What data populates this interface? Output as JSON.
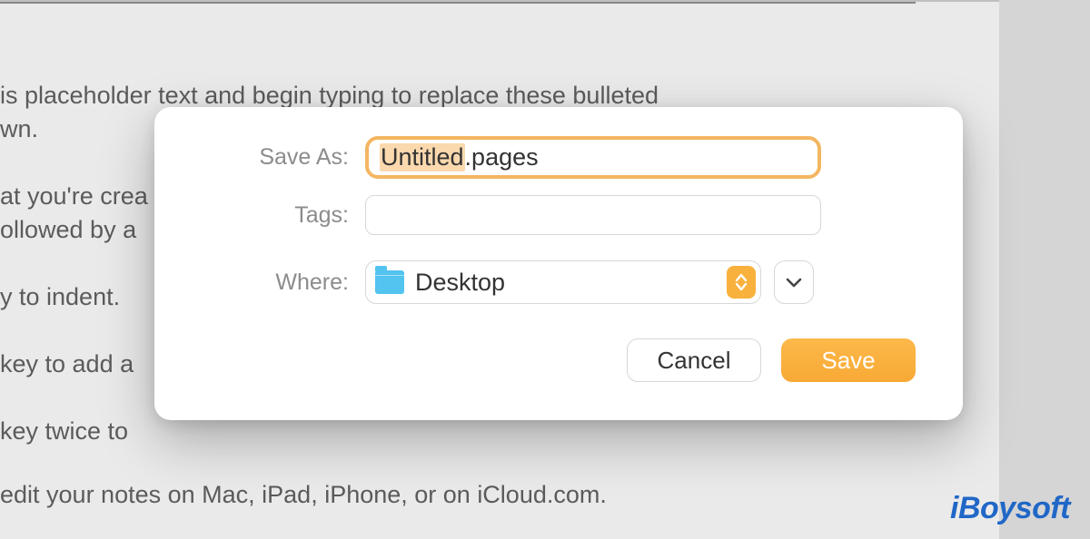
{
  "document": {
    "line1": "is placeholder text and begin typing to replace these bulleted",
    "line2": "wn.",
    "line3": "at you're crea",
    "line4": "ollowed by a",
    "line5": "y to indent.",
    "line6": "key to add a",
    "line7": "key twice to",
    "line8": "edit your notes on Mac, iPad, iPhone, or on iCloud.com."
  },
  "dialog": {
    "saveAsLabel": "Save As:",
    "filenameSelected": "Untitled",
    "filenameExt": ".pages",
    "tagsLabel": "Tags:",
    "tagsValue": "",
    "whereLabel": "Where:",
    "whereValue": "Desktop",
    "cancelLabel": "Cancel",
    "saveLabel": "Save"
  },
  "watermark": "iBoysoft"
}
